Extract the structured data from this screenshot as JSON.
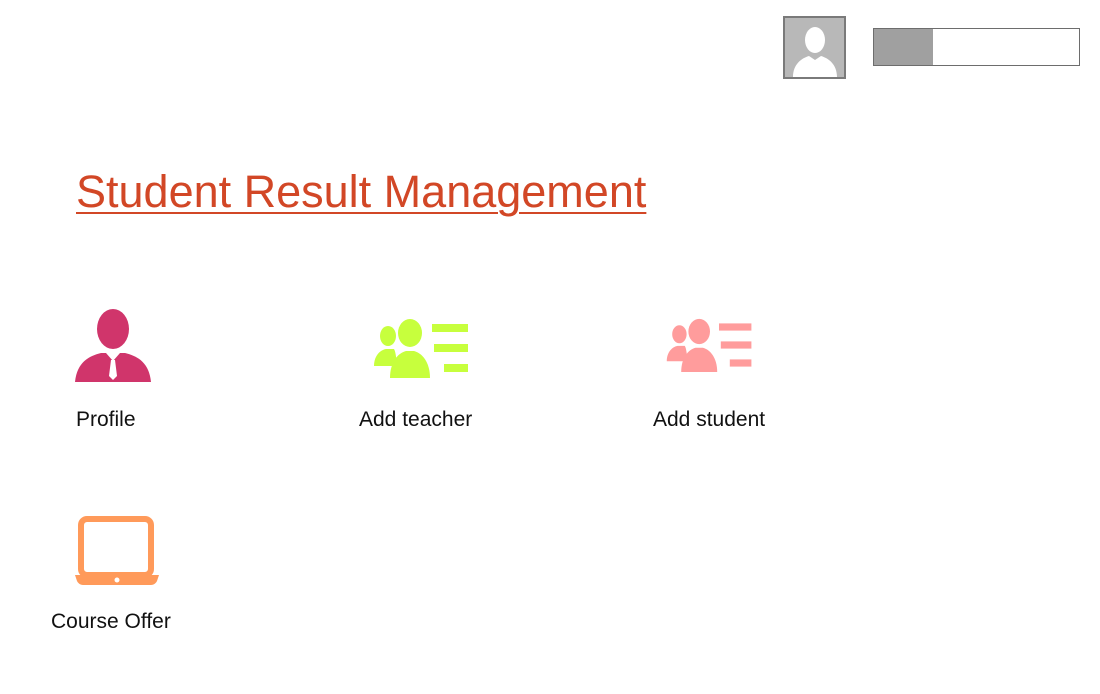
{
  "header": {
    "avatar_icon": "user-silhouette-icon",
    "user_bar_level": 0.29
  },
  "page": {
    "title": "Student Result Management"
  },
  "tiles": [
    {
      "label": "Profile",
      "icon": "person-with-tie-icon",
      "color": "#d0356b"
    },
    {
      "label": "Add teacher",
      "icon": "contact-card-icon",
      "color": "#c7ff3d"
    },
    {
      "label": "Add student",
      "icon": "contact-card-icon",
      "color": "#ff9c9c"
    },
    {
      "label": "Course Offer",
      "icon": "laptop-icon",
      "color": "#ff9a5a"
    }
  ]
}
